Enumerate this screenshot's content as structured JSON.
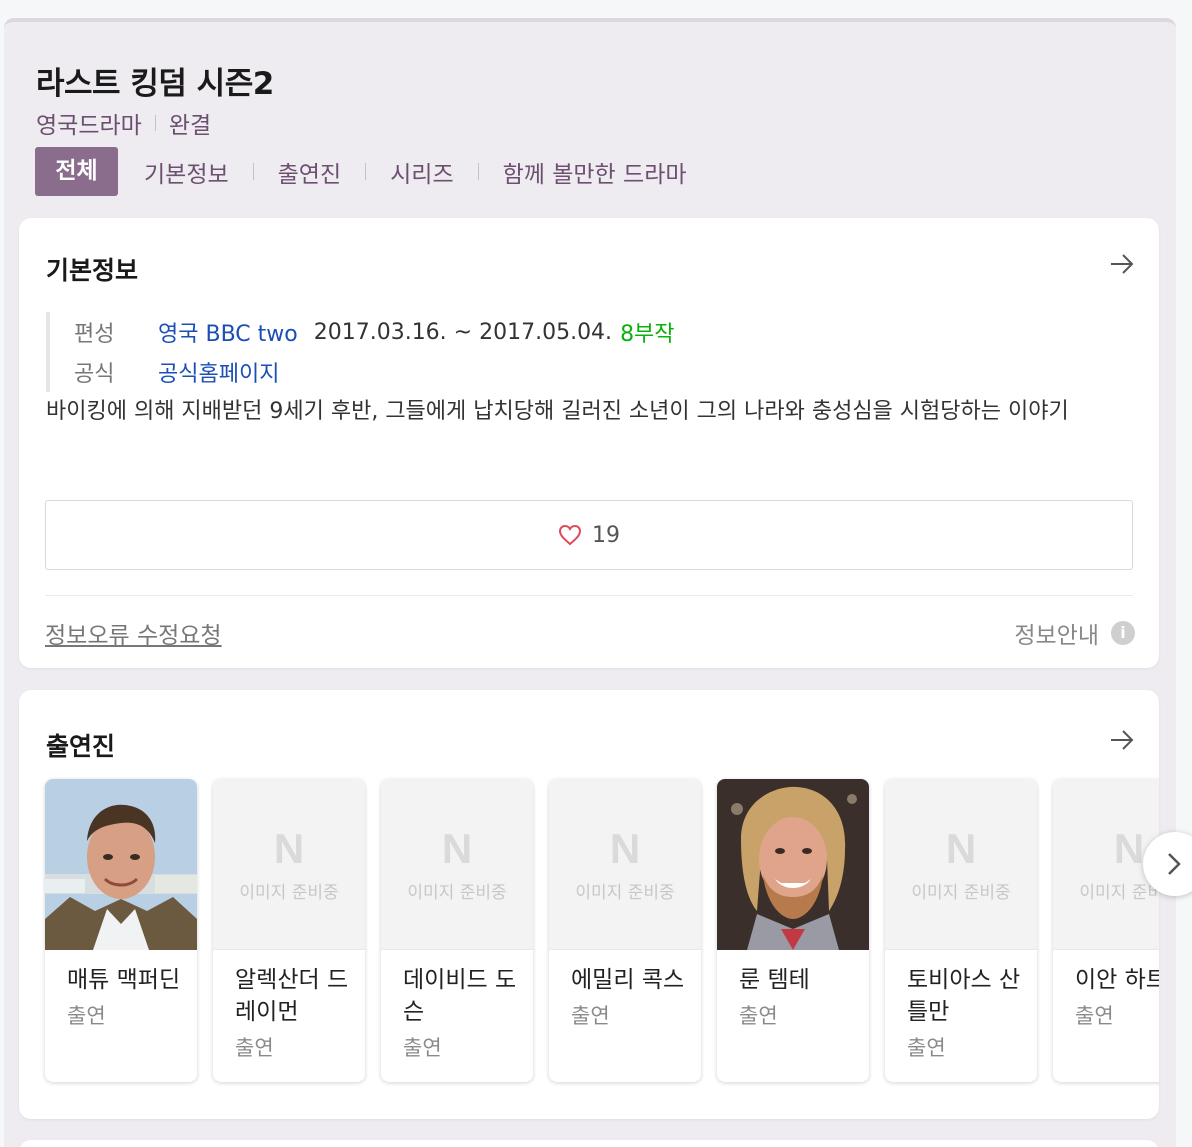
{
  "header": {
    "title": "라스트 킹덤 시즌2",
    "genre": "영국드라마",
    "status": "완결"
  },
  "tabs": [
    {
      "label": "전체",
      "active": true
    },
    {
      "label": "기본정보"
    },
    {
      "label": "출연진"
    },
    {
      "label": "시리즈"
    },
    {
      "label": "함께 볼만한 드라마"
    }
  ],
  "basic_info": {
    "section_title": "기본정보",
    "broadcast_label": "편성",
    "channel": "영국 BBC two",
    "period": "2017.03.16. ~ 2017.05.04.",
    "episodes": "8부작",
    "official_label": "공식",
    "official_link": "공식홈페이지",
    "description": "바이킹에 의해 지배받던 9세기 후반, 그들에게 납치당해 길러진 소년이 그의 나라와 충성심을 시험당하는 이야기",
    "like_count": "19",
    "report_link": "정보오류 수정요청",
    "notice_label": "정보안내",
    "info_icon_glyph": "i"
  },
  "cast": {
    "section_title": "출연진",
    "placeholder_logo": "N",
    "placeholder_text": "이미지 준비중",
    "members": [
      {
        "name": "매튜 맥퍼딘",
        "role": "출연",
        "photo": "person-photo"
      },
      {
        "name": "알렉산더 드레이먼",
        "role": "출연",
        "photo": "placeholder"
      },
      {
        "name": "데이비드 도슨",
        "role": "출연",
        "photo": "placeholder"
      },
      {
        "name": "에밀리 콕스",
        "role": "출연",
        "photo": "placeholder"
      },
      {
        "name": "룬 템테",
        "role": "출연",
        "photo": "person-photo"
      },
      {
        "name": "토비아스 산틀만",
        "role": "출연",
        "photo": "placeholder"
      },
      {
        "name": "이안 하트",
        "role": "출연",
        "photo": "placeholder"
      }
    ]
  },
  "colors": {
    "accent": "#8a6c8d",
    "link": "#1b4fb5",
    "episodes": "#0bb10b",
    "heart": "#e04a5a"
  }
}
